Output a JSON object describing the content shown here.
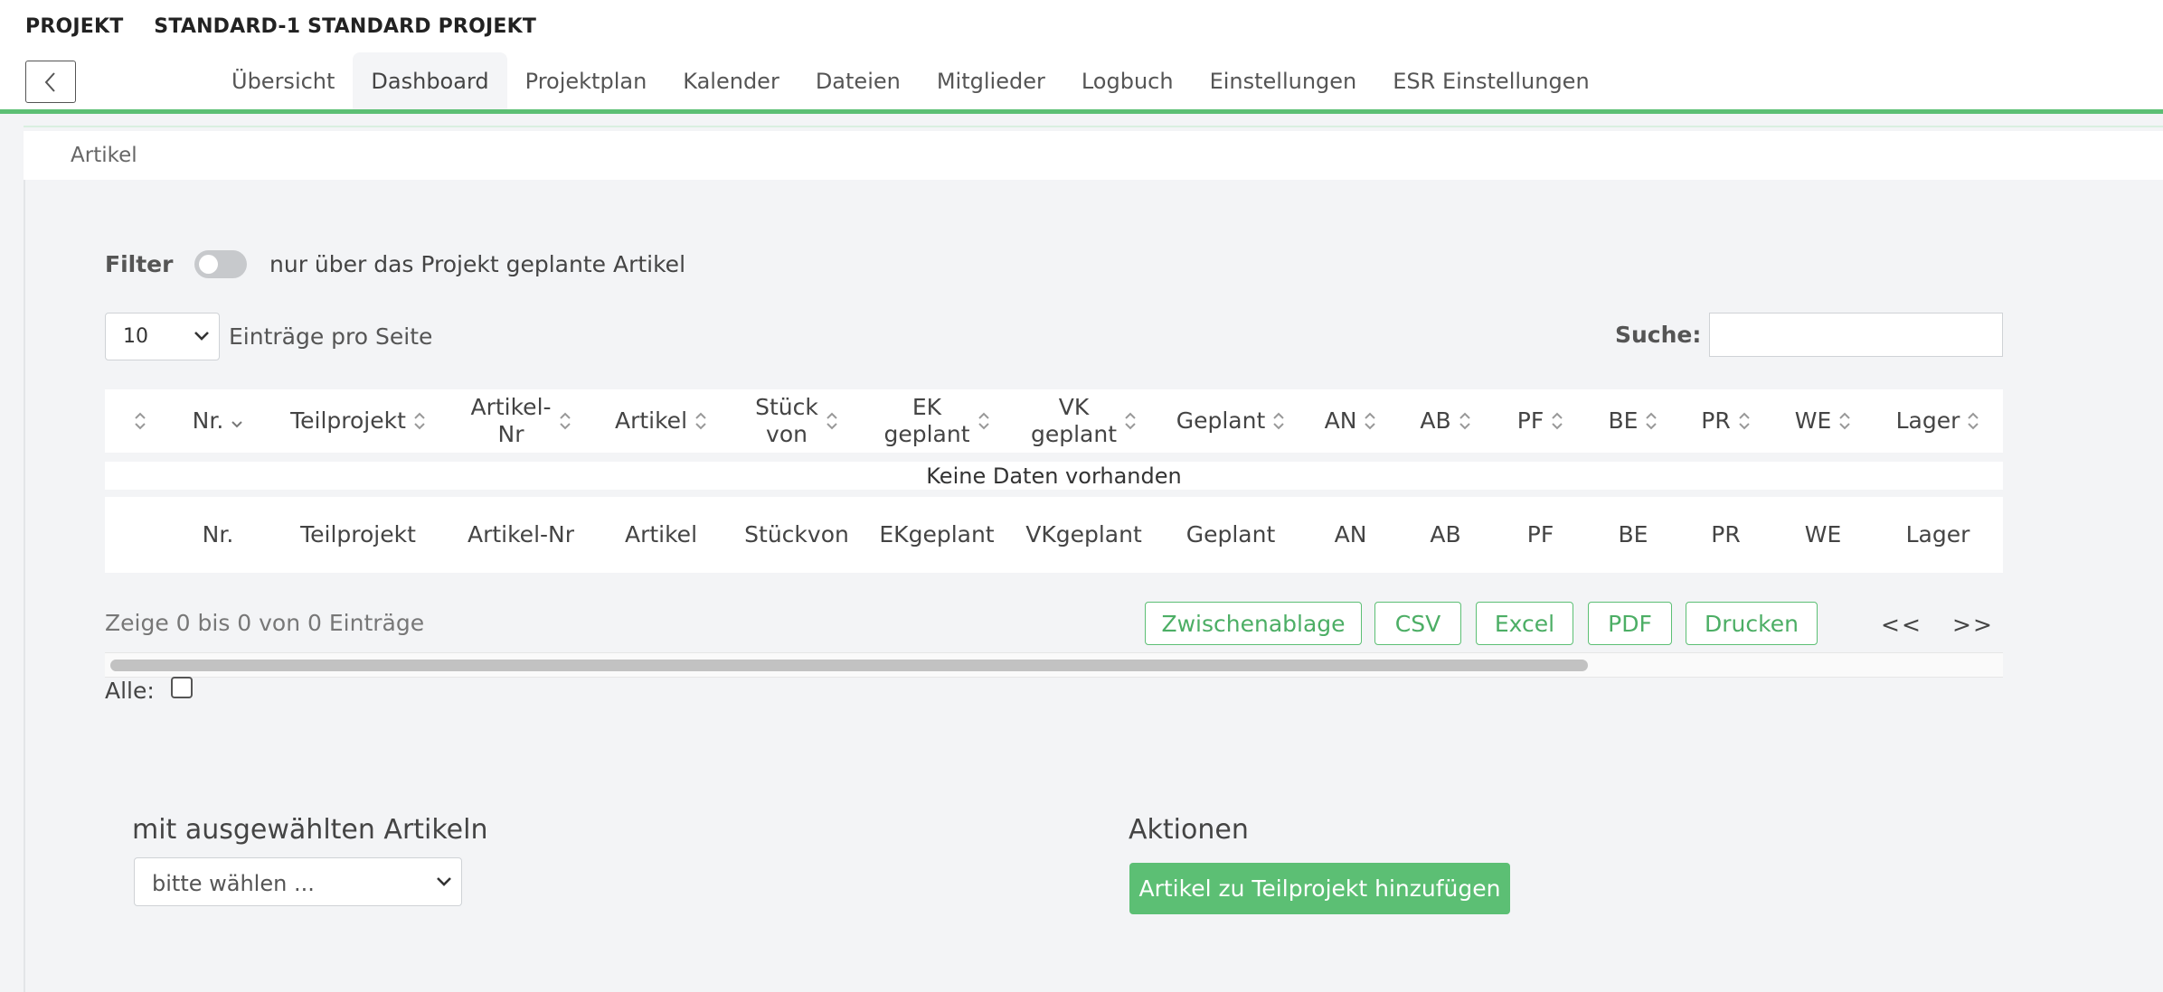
{
  "header": {
    "project_label": "PROJEKT",
    "project_name": "STANDARD-1 STANDARD PROJEKT",
    "tabs": [
      {
        "label": "Übersicht"
      },
      {
        "label": "Dashboard"
      },
      {
        "label": "Projektplan"
      },
      {
        "label": "Kalender"
      },
      {
        "label": "Dateien"
      },
      {
        "label": "Mitglieder"
      },
      {
        "label": "Logbuch"
      },
      {
        "label": "Einstellungen"
      },
      {
        "label": "ESR Einstellungen"
      }
    ],
    "active_tab": "Dashboard"
  },
  "section": {
    "title": "Artikel"
  },
  "filter": {
    "label": "Filter",
    "toggle_text": "nur über das Projekt geplante Artikel",
    "enabled": false
  },
  "table_controls": {
    "page_length": "10",
    "page_length_text": "Einträge pro Seite",
    "search_label": "Suche:",
    "search_value": ""
  },
  "table": {
    "columns": [
      {
        "line1": "",
        "line2": ""
      },
      {
        "line1": "Nr.",
        "line2": ""
      },
      {
        "line1": "Teilprojekt",
        "line2": ""
      },
      {
        "line1": "Artikel-",
        "line2": "Nr"
      },
      {
        "line1": "Artikel",
        "line2": ""
      },
      {
        "line1": "Stück",
        "line2": "von"
      },
      {
        "line1": "EK",
        "line2": "geplant"
      },
      {
        "line1": "VK",
        "line2": "geplant"
      },
      {
        "line1": "Geplant",
        "line2": ""
      },
      {
        "line1": "AN",
        "line2": ""
      },
      {
        "line1": "AB",
        "line2": ""
      },
      {
        "line1": "PF",
        "line2": ""
      },
      {
        "line1": "BE",
        "line2": ""
      },
      {
        "line1": "PR",
        "line2": ""
      },
      {
        "line1": "WE",
        "line2": ""
      },
      {
        "line1": "Lager",
        "line2": ""
      }
    ],
    "empty_message": "Keine Daten vorhanden",
    "info": "Zeige 0 bis 0 von 0 Einträge",
    "export_buttons": [
      "Zwischenablage",
      "CSV",
      "Excel",
      "PDF",
      "Drucken"
    ],
    "pager_prev": "<<",
    "pager_next": ">>"
  },
  "select_all": {
    "label": "Alle:",
    "checked": false
  },
  "bulk": {
    "title": "mit ausgewählten Artikeln",
    "select_value": "bitte wählen ..."
  },
  "actions": {
    "title": "Aktionen",
    "add_button": "Artikel zu Teilprojekt hinzufügen"
  },
  "colors": {
    "accent": "#5cbf74"
  }
}
